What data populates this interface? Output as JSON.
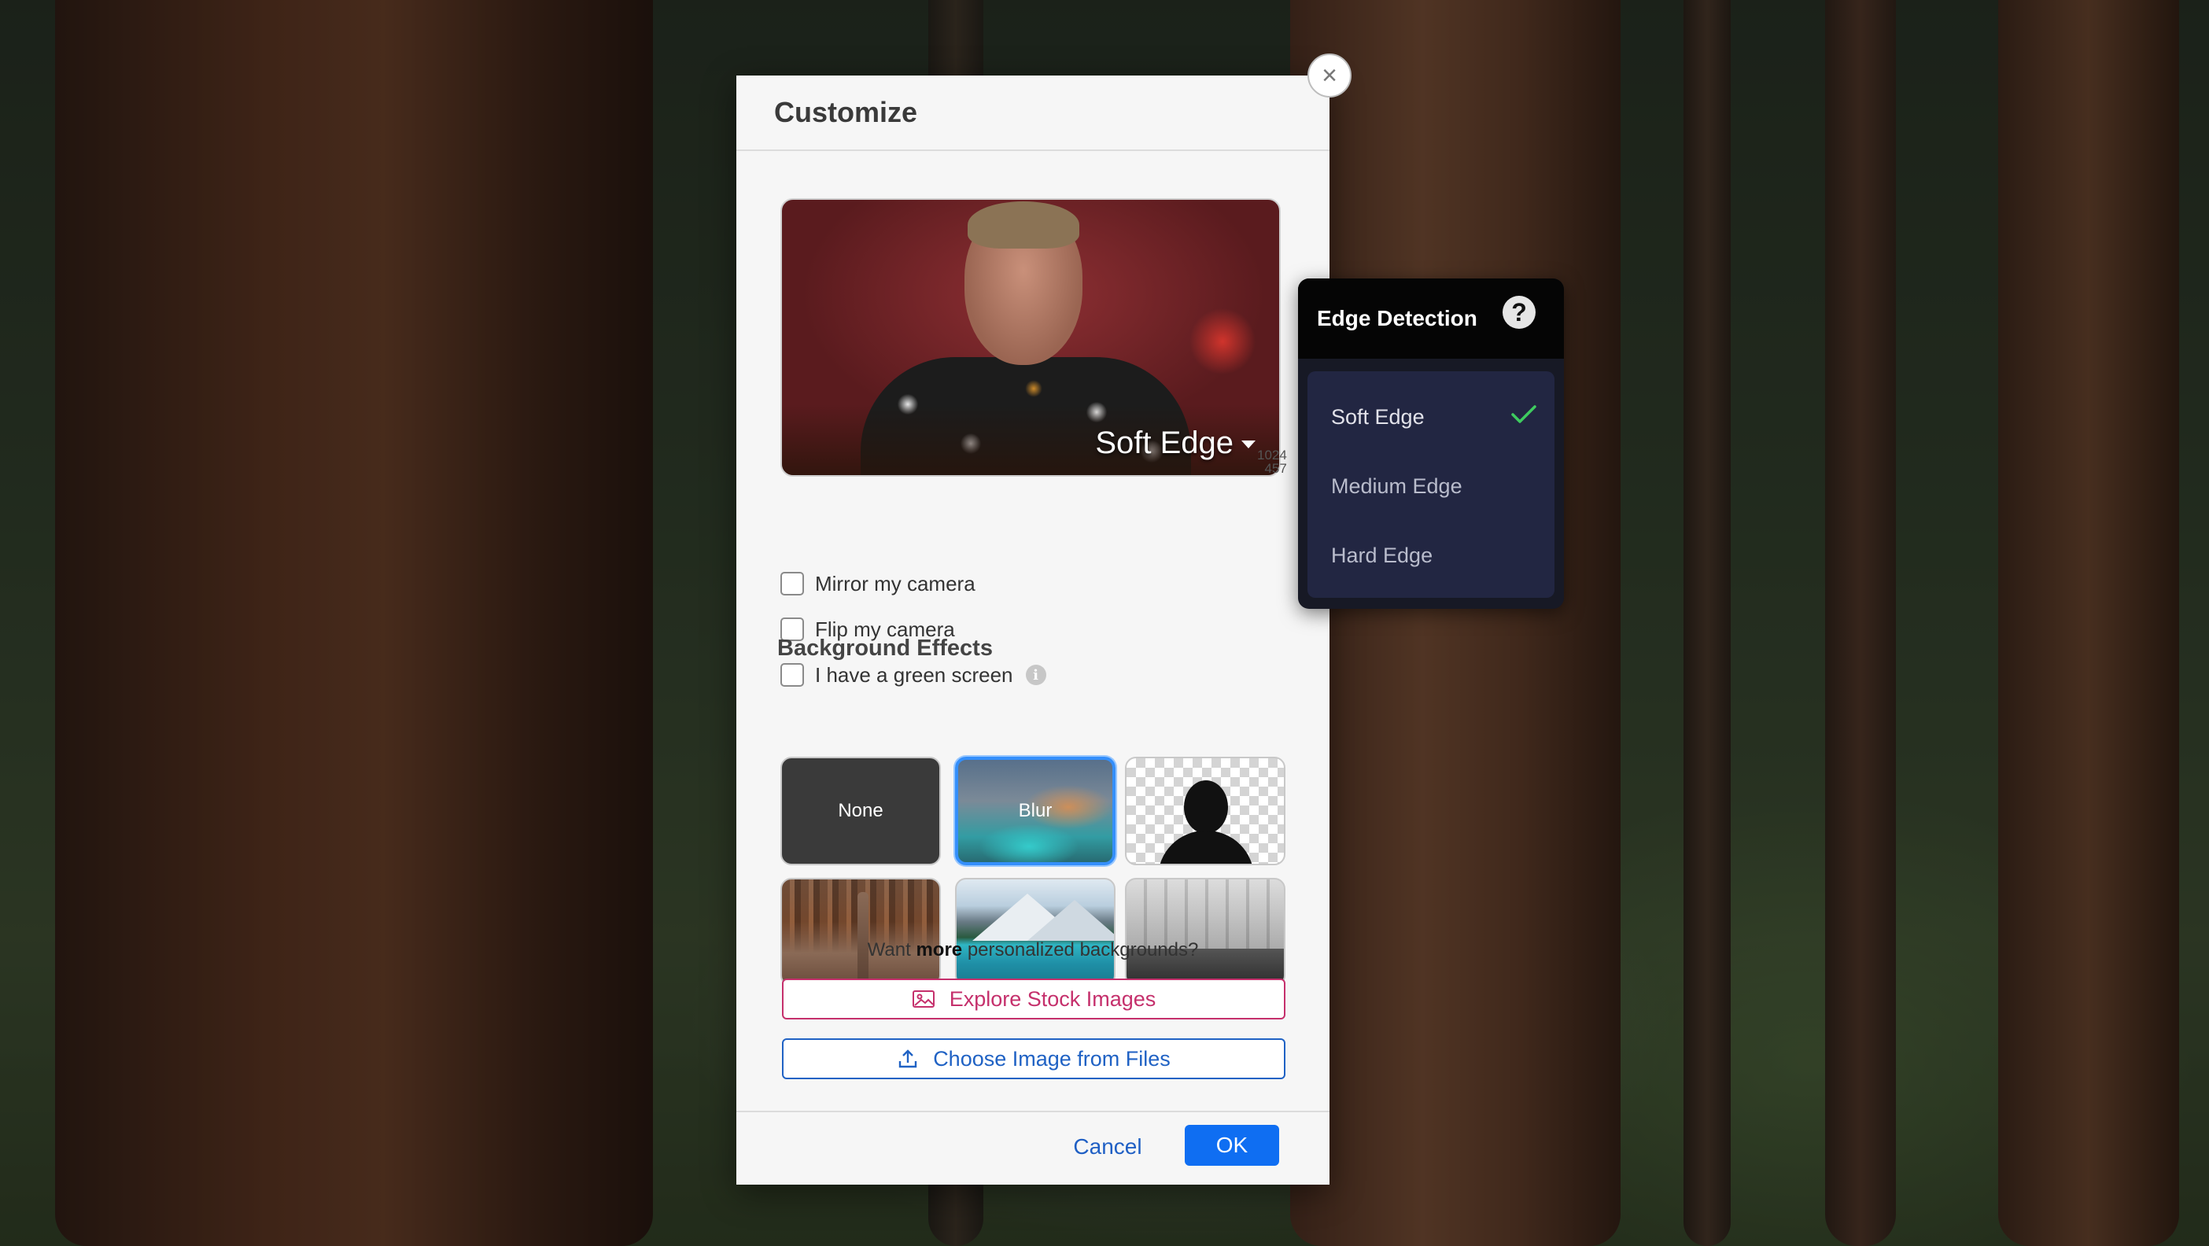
{
  "dialog": {
    "title": "Customize",
    "preview": {
      "label": "Soft Edge",
      "resolution_top": "1024",
      "resolution_bottom": "457"
    },
    "options": [
      {
        "label": "Mirror my camera"
      },
      {
        "label": "Flip my camera"
      },
      {
        "label": "I have a green screen"
      }
    ],
    "info_glyph": "i",
    "background_effects": {
      "title": "Background Effects",
      "tiles": [
        {
          "label": "None"
        },
        {
          "label": "Blur",
          "selected": true
        },
        {
          "label": "",
          "icon": "person-silhouette-icon"
        },
        {
          "label": "",
          "image": "city-skyline"
        },
        {
          "label": "",
          "image": "mountain-lake"
        },
        {
          "label": "",
          "image": "office-space"
        }
      ]
    },
    "more_prefix": "Want",
    "more_bold": "more",
    "more_suffix": "personalized backgrounds?",
    "explore_label": "Explore Stock Images",
    "choose_label": "Choose Image from Files",
    "cancel_label": "Cancel",
    "ok_label": "OK",
    "close_glyph": "×"
  },
  "edge_detection": {
    "title": "Edge Detection",
    "help_glyph": "?",
    "items": [
      {
        "label": "Soft Edge",
        "checked": true
      },
      {
        "label": "Medium Edge",
        "checked": false
      },
      {
        "label": "Hard Edge",
        "checked": false
      }
    ]
  },
  "colors": {
    "accent_blue": "#0f6ef2",
    "stock_pink": "#c5306c",
    "files_blue": "#2062c4",
    "selected_border": "#3b8ef0",
    "check_green": "#3ecb5f"
  }
}
